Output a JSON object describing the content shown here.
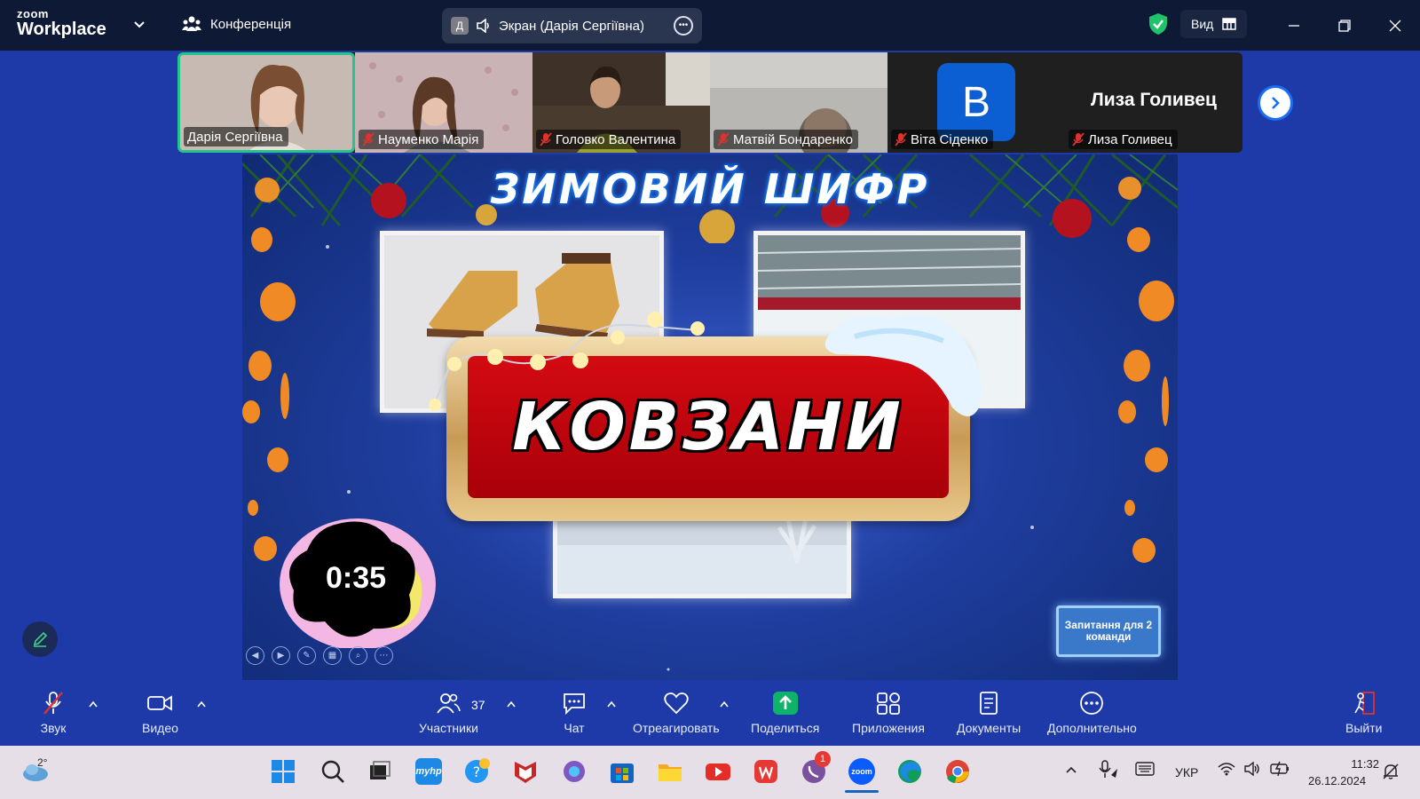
{
  "topbar": {
    "logo_line1": "zoom",
    "logo_line2": "Workplace",
    "conference_label": "Конференція",
    "screen_share_initial": "Д",
    "screen_share_label": "Экран (Дарія Сергіївна)",
    "view_label": "Вид"
  },
  "participants": [
    {
      "name": "Дарія Сергіївна",
      "muted": false,
      "active": true
    },
    {
      "name": "Науменко Марія",
      "muted": true,
      "active": false
    },
    {
      "name": "Головко Валентина",
      "muted": true,
      "active": false
    },
    {
      "name": "Матвій Бондаренко",
      "muted": true,
      "active": false
    },
    {
      "name": "Віта Сіденко",
      "muted": true,
      "active": false,
      "avatar_letter": "В"
    },
    {
      "name": "Лиза Голивец",
      "muted": true,
      "active": false,
      "display_name": "Лиза Голивец"
    }
  ],
  "slide": {
    "title": "ЗИМОВИЙ ШИФР",
    "answer": "КОВЗАНИ",
    "timer": "0:35",
    "question_button": "Запитання для 2 команди"
  },
  "toolbar": {
    "audio": "Звук",
    "video": "Видео",
    "participants": "Участники",
    "participants_count": "37",
    "chat": "Чат",
    "react": "Отреагировать",
    "share": "Поделиться",
    "apps": "Приложения",
    "docs": "Документы",
    "more": "Дополнительно",
    "leave": "Выйти"
  },
  "taskbar": {
    "weather": "2°",
    "language": "УКР",
    "time": "11:32",
    "date": "26.12.2024",
    "viber_badge": "1"
  },
  "colors": {
    "topbar_bg": "#0e1a35",
    "meeting_bg": "#1d3aa8",
    "active_speaker": "#22c58b",
    "share_green": "#0eb36a",
    "muted_red": "#e0322d"
  }
}
